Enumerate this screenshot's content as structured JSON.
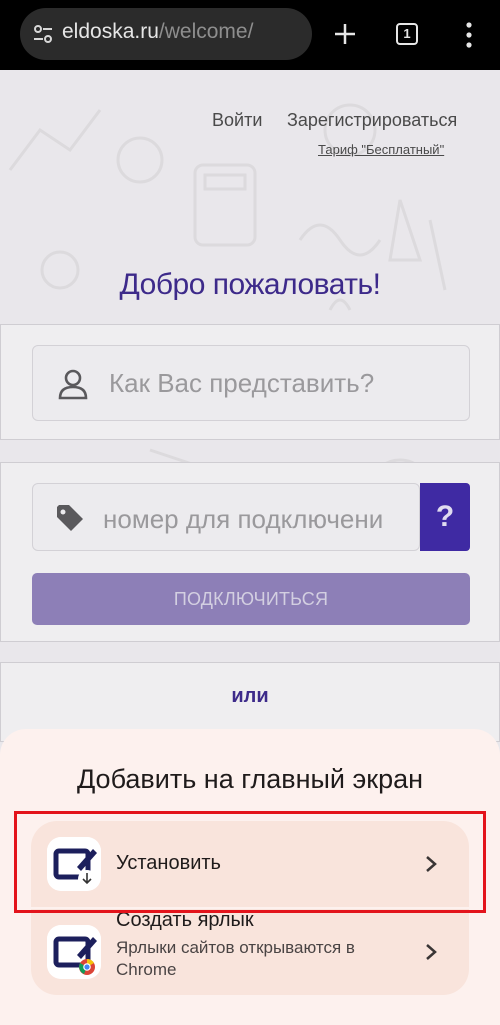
{
  "browser": {
    "url_domain": "eldoska.ru",
    "url_path": "/welcome/",
    "tab_count": "1"
  },
  "page": {
    "login_label": "Войти",
    "register_label": "Зарегистрироваться",
    "tariff_label": "Тариф \"Бесплатный\"",
    "welcome_title": "Добро пожаловать!",
    "name_placeholder": "Как Вас представить?",
    "number_placeholder": "номер для подключени",
    "help_label": "?",
    "connect_label": "ПОДКЛЮЧИТЬСЯ",
    "or_label": "или"
  },
  "sheet": {
    "title": "Добавить на главный экран",
    "options": [
      {
        "label": "Установить"
      },
      {
        "label": "Создать ярлык",
        "sub": "Ярлыки сайтов открываются в Chrome"
      }
    ]
  },
  "colors": {
    "accent": "#3f2aa3",
    "highlight": "#e3131b",
    "sheet_bg": "#fdf1ee"
  }
}
